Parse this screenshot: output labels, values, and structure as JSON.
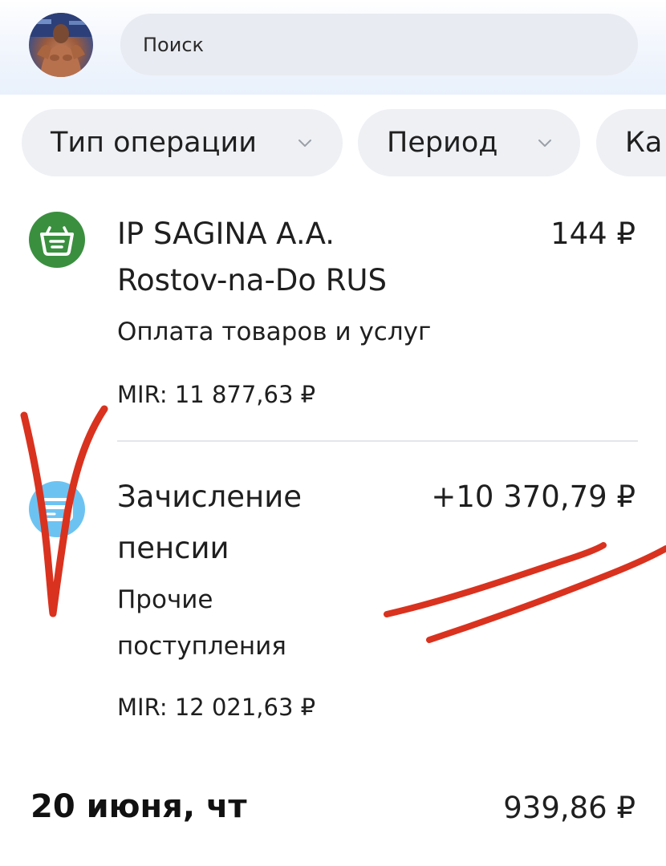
{
  "header": {
    "avatar_icon": "user-avatar",
    "search_label": "Поиск"
  },
  "filters": {
    "type_label": "Тип операции",
    "period_label": "Период",
    "category_label_partial": "Ка",
    "chevron_icon": "chevron-down-icon"
  },
  "transactions": [
    {
      "icon": "shopping-basket-icon",
      "icon_color": "#3a8f3f",
      "title_line_1": "IP SAGINA A.A.",
      "title_line_2": "Rostov-na-Do RUS",
      "amount": "144 ₽",
      "category": "Оплата товаров и услуг",
      "card_balance": "MIR: 11 877,63 ₽"
    },
    {
      "icon": "card-icon",
      "icon_color": "#6cc3f2",
      "title_line_1": "Зачисление",
      "title_line_2": "пенсии",
      "amount": "+10 370,79 ₽",
      "category_line_1": "Прочие",
      "category_line_2": "поступления",
      "card_balance": "MIR: 12 021,63 ₽"
    }
  ],
  "day_group": {
    "date": "20 июня, чт",
    "total": "939,86 ₽"
  },
  "annotation_color": "#d9321f"
}
